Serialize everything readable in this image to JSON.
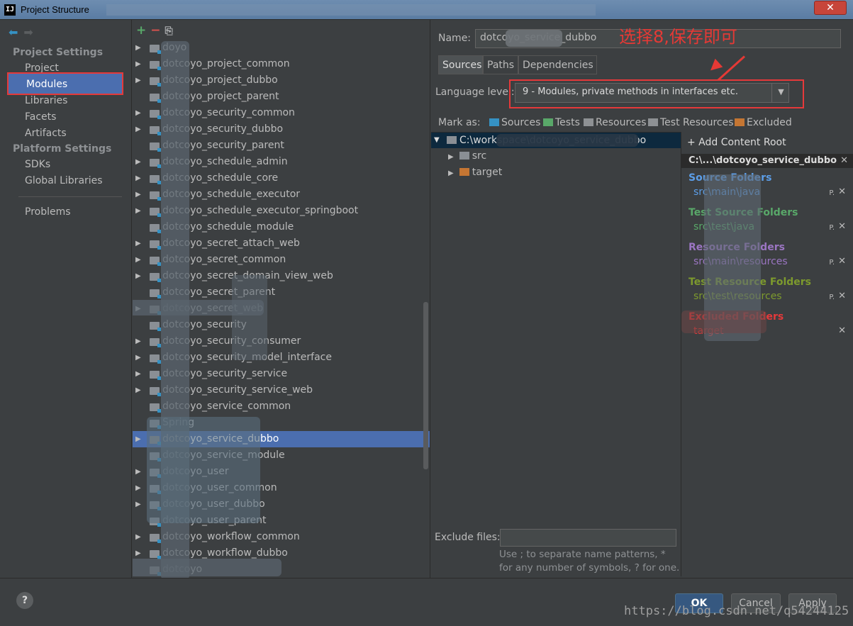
{
  "window": {
    "title": "Project Structure",
    "app_icon": "IJ",
    "close_glyph": "✕"
  },
  "sidebar": {
    "project_settings_title": "Project Settings",
    "project_items": [
      "Project",
      "Modules",
      "Libraries",
      "Facets",
      "Artifacts"
    ],
    "platform_settings_title": "Platform Settings",
    "platform_items": [
      "SDKs",
      "Global Libraries"
    ],
    "problems": "Problems",
    "selected": "Modules"
  },
  "tree": {
    "toolbar": {
      "add": "+",
      "remove": "−",
      "copy": "⎘"
    },
    "rows": [
      {
        "label": "doyo",
        "expandable": true
      },
      {
        "label": "dotcoyo_project_common",
        "expandable": true
      },
      {
        "label": "dotcoyo_project_dubbo",
        "expandable": true
      },
      {
        "label": "dotcoyo_project_parent",
        "expandable": false
      },
      {
        "label": "dotcoyo_security_common",
        "expandable": true
      },
      {
        "label": "dotcoyo_security_dubbo",
        "expandable": true
      },
      {
        "label": "dotcoyo_security_parent",
        "expandable": false
      },
      {
        "label": "dotcoyo_schedule_admin",
        "expandable": true
      },
      {
        "label": "dotcoyo_schedule_core",
        "expandable": true
      },
      {
        "label": "dotcoyo_schedule_executor",
        "expandable": true
      },
      {
        "label": "dotcoyo_schedule_executor_springboot",
        "expandable": true
      },
      {
        "label": "dotcoyo_schedule_module",
        "expandable": false
      },
      {
        "label": "dotcoyo_secret_attach_web",
        "expandable": true
      },
      {
        "label": "dotcoyo_secret_common",
        "expandable": true
      },
      {
        "label": "dotcoyo_secret_domain_view_web",
        "expandable": true
      },
      {
        "label": "dotcoyo_secret_parent",
        "expandable": false
      },
      {
        "label": "dotcoyo_secret_web",
        "expandable": true
      },
      {
        "label": "dotcoyo_security",
        "expandable": false
      },
      {
        "label": "dotcoyo_security_consumer",
        "expandable": true
      },
      {
        "label": "dotcoyo_security_model_interface",
        "expandable": true
      },
      {
        "label": "dotcoyo_security_service",
        "expandable": true
      },
      {
        "label": "dotcoyo_security_service_web",
        "expandable": true
      },
      {
        "label": "dotcoyo_service_common",
        "expandable": false
      },
      {
        "label": "Spring",
        "expandable": false
      },
      {
        "label": "dotcoyo_service_dubbo",
        "expandable": true,
        "selected": true
      },
      {
        "label": "dotcoyo_service_module",
        "expandable": false
      },
      {
        "label": "dotcoyo_user",
        "expandable": true
      },
      {
        "label": "dotcoyo_user_common",
        "expandable": true
      },
      {
        "label": "dotcoyo_user_dubbo",
        "expandable": true
      },
      {
        "label": "dotcoyo_user_parent",
        "expandable": false
      },
      {
        "label": "dotcoyo_workflow_common",
        "expandable": true
      },
      {
        "label": "dotcoyo_workflow_dubbo",
        "expandable": true
      },
      {
        "label": "dotcoyo",
        "expandable": false
      }
    ]
  },
  "module": {
    "name_label": "Name:",
    "name_value": "dotcoyo_service_dubbo",
    "annotation": "选择8,保存即可",
    "tabs": [
      "Sources",
      "Paths",
      "Dependencies"
    ],
    "active_tab": "Sources",
    "language_level_label": "Language level:",
    "language_level_value": "9 - Modules, private methods in interfaces etc.",
    "mark_as_label": "Mark as:",
    "mark_as": [
      {
        "label": "Sources",
        "color": "#3592c4"
      },
      {
        "label": "Tests",
        "color": "#59a869"
      },
      {
        "label": "Resources",
        "color": "#8e9194"
      },
      {
        "label": "Test Resources",
        "color": "#8e9194"
      },
      {
        "label": "Excluded",
        "color": "#c57633"
      }
    ],
    "content_tree": {
      "root": "C:\\workspace\\dotcoyo_service_dubbo",
      "children": [
        "src",
        "target"
      ]
    },
    "roots_panel": {
      "add_content_root": "+ Add Content Root",
      "root_header": "C:\\...\\dotcoyo_service_dubbo",
      "categories": [
        {
          "title": "Source Folders",
          "path": "src\\main\\java",
          "color": "#5c9ee8"
        },
        {
          "title": "Test Source Folders",
          "path": "src\\test\\java",
          "color": "#59a869"
        },
        {
          "title": "Resource Folders",
          "path": "src\\main\\resources",
          "color": "#9b75c2"
        },
        {
          "title": "Test Resource Folders",
          "path": "src\\test\\resources",
          "color": "#7d9a2d"
        },
        {
          "title": "Excluded Folders",
          "path": "target",
          "color": "#e5393a"
        }
      ]
    },
    "exclude_files_label": "Exclude files:",
    "exclude_files_value": "",
    "exclude_hint_line1": "Use ; to separate name patterns, *",
    "exclude_hint_line2": "for any number of symbols, ? for one."
  },
  "footer": {
    "help": "?",
    "ok": "OK",
    "cancel": "Cancel",
    "apply": "Apply",
    "watermark": "https://blog.csdn.net/q54244125"
  }
}
